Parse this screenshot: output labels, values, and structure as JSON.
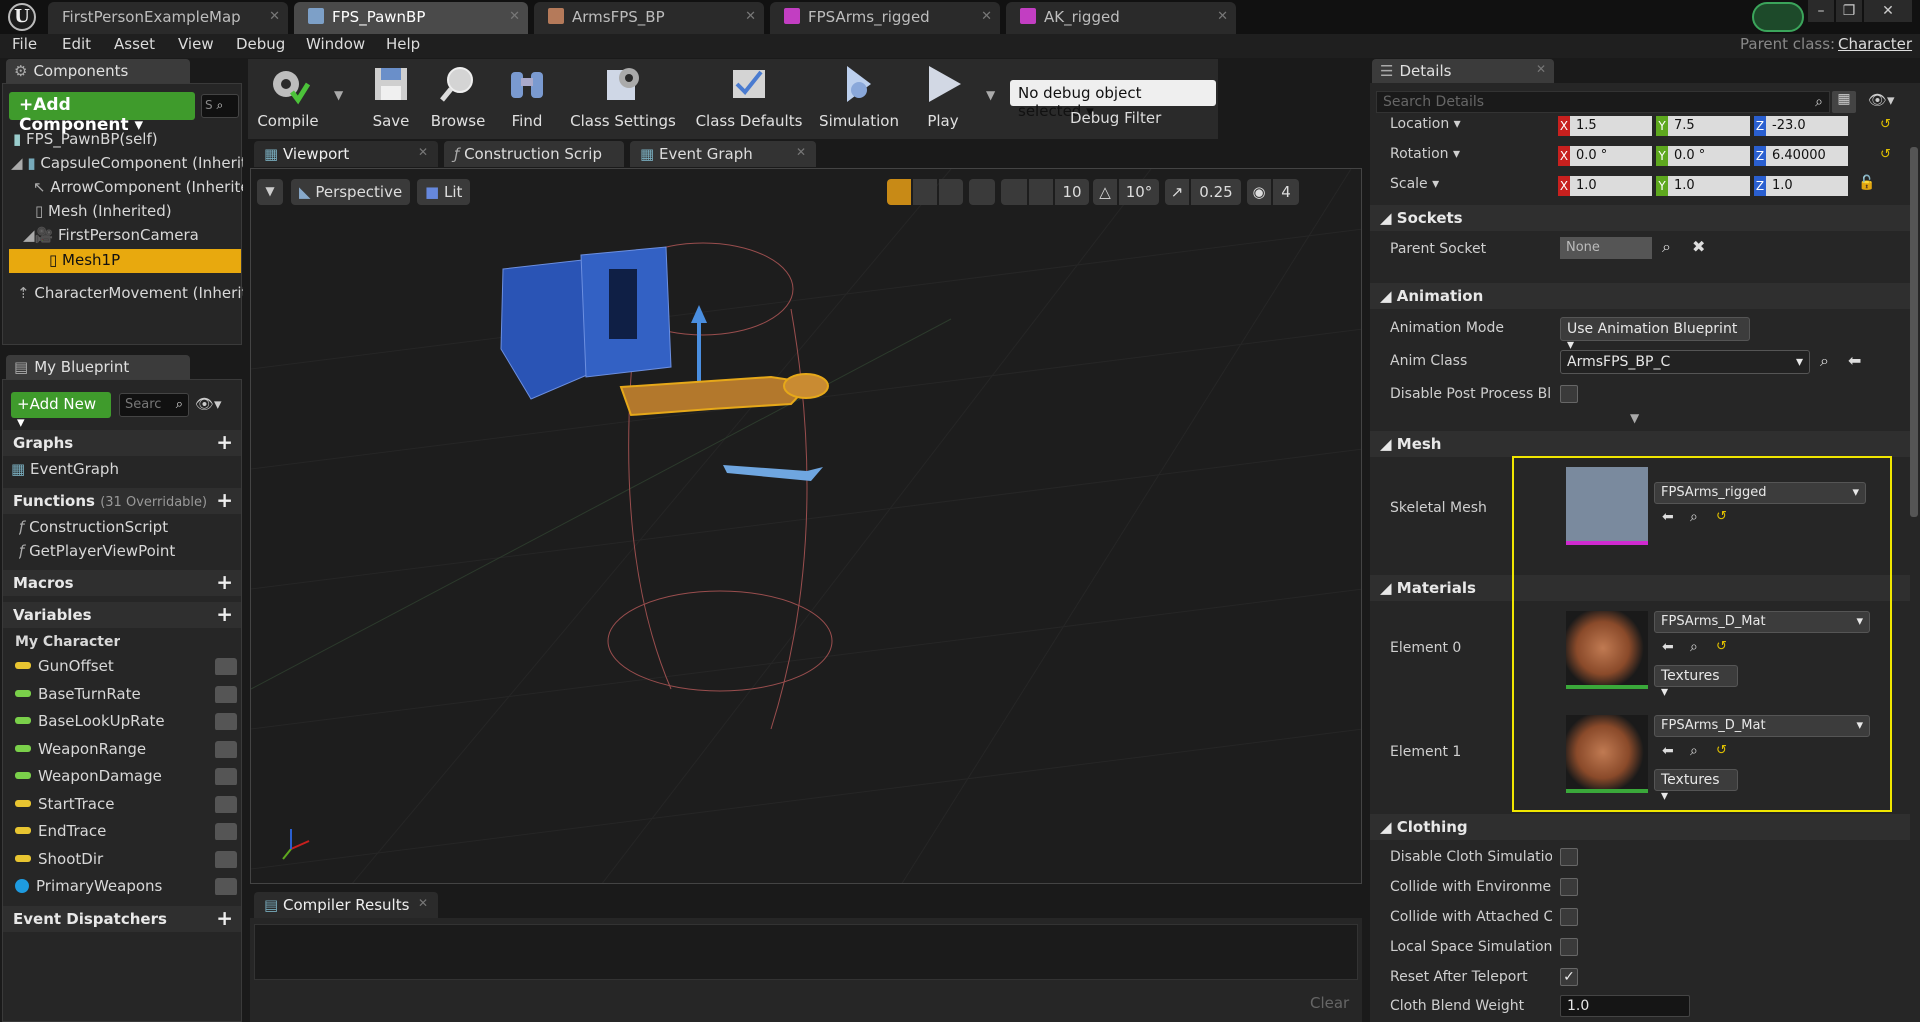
{
  "tabs": [
    {
      "label": "FirstPersonExampleMap",
      "active": false
    },
    {
      "label": "FPS_PawnBP",
      "active": true
    },
    {
      "label": "ArmsFPS_BP",
      "active": false
    },
    {
      "label": "FPSArms_rigged",
      "active": false
    },
    {
      "label": "AK_rigged",
      "active": false
    }
  ],
  "menu": [
    "File",
    "Edit",
    "Asset",
    "View",
    "Debug",
    "Window",
    "Help"
  ],
  "parent_class": {
    "label": "Parent class:",
    "value": "Character"
  },
  "components": {
    "title": "Components",
    "add_button": "+Add Component",
    "search_placeholder": "S",
    "root": "FPS_PawnBP(self)",
    "items": [
      {
        "label": "CapsuleComponent (Inherite"
      },
      {
        "label": "ArrowComponent (Inherite"
      },
      {
        "label": "Mesh (Inherited)"
      },
      {
        "label": "FirstPersonCamera"
      },
      {
        "label": "Mesh1P",
        "selected": true
      },
      {
        "label": "CharacterMovement (Inherit"
      }
    ]
  },
  "my_blueprint": {
    "title": "My Blueprint",
    "add_new": "Add New",
    "search_placeholder": "Searc",
    "graphs": {
      "label": "Graphs",
      "items": [
        "EventGraph"
      ]
    },
    "functions": {
      "label": "Functions",
      "count": "(31 Overridable)",
      "items": [
        "ConstructionScript",
        "GetPlayerViewPoint"
      ]
    },
    "macros": "Macros",
    "variables": {
      "label": "Variables",
      "category": "My Character",
      "items": [
        {
          "name": "GunOffset",
          "color": "#e8c531"
        },
        {
          "name": "BaseTurnRate",
          "color": "#7ad04a"
        },
        {
          "name": "BaseLookUpRate",
          "color": "#7ad04a"
        },
        {
          "name": "WeaponRange",
          "color": "#7ad04a"
        },
        {
          "name": "WeaponDamage",
          "color": "#7ad04a"
        },
        {
          "name": "StartTrace",
          "color": "#e8c531"
        },
        {
          "name": "EndTrace",
          "color": "#e8c531"
        },
        {
          "name": "ShootDir",
          "color": "#e8c531"
        },
        {
          "name": "PrimaryWeapons",
          "color": "#1e9be0"
        }
      ]
    },
    "event_dispatchers": "Event Dispatchers"
  },
  "toolbar": {
    "buttons": [
      "Compile",
      "Save",
      "Browse",
      "Find",
      "Class Settings",
      "Class Defaults",
      "Simulation",
      "Play"
    ],
    "debug_select": "No debug object selected",
    "debug_filter": "Debug Filter"
  },
  "editor_tabs": [
    "Viewport",
    "Construction Scrip",
    "Event Graph"
  ],
  "viewport": {
    "perspective": "Perspective",
    "lit": "Lit",
    "grid_snap": "10",
    "rot_snap": "10°",
    "scale_snap": "0.25",
    "cam_speed": "4"
  },
  "compiler": {
    "title": "Compiler Results",
    "clear": "Clear"
  },
  "details": {
    "title": "Details",
    "search_placeholder": "Search Details",
    "transform": {
      "location": {
        "label": "Location",
        "x": "1.5",
        "y": "7.5",
        "z": "-23.0"
      },
      "rotation": {
        "label": "Rotation",
        "x": "0.0 °",
        "y": "0.0 °",
        "z": "6.40000"
      },
      "scale": {
        "label": "Scale",
        "x": "1.0",
        "y": "1.0",
        "z": "1.0"
      }
    },
    "sockets": {
      "header": "Sockets",
      "parent_socket_label": "Parent Socket",
      "parent_socket_value": "None"
    },
    "animation": {
      "header": "Animation",
      "mode_label": "Animation Mode",
      "mode_value": "Use Animation Blueprint",
      "class_label": "Anim Class",
      "class_value": "ArmsFPS_BP_C",
      "disable_pp_label": "Disable Post Process Blu"
    },
    "mesh": {
      "header": "Mesh",
      "skeletal_label": "Skeletal Mesh",
      "skeletal_value": "FPSArms_rigged"
    },
    "materials": {
      "header": "Materials",
      "elements": [
        {
          "label": "Element 0",
          "value": "FPSArms_D_Mat",
          "textures": "Textures"
        },
        {
          "label": "Element 1",
          "value": "FPSArms_D_Mat",
          "textures": "Textures"
        }
      ]
    },
    "clothing": {
      "header": "Clothing",
      "options": [
        {
          "label": "Disable Cloth Simulation",
          "checked": false
        },
        {
          "label": "Collide with Environment",
          "checked": false
        },
        {
          "label": "Collide with Attached Chi",
          "checked": false
        },
        {
          "label": "Local Space Simulation",
          "checked": false
        },
        {
          "label": "Reset After Teleport",
          "checked": true
        }
      ],
      "blend_label": "Cloth Blend Weight",
      "blend_value": "1.0"
    }
  },
  "colors": {
    "highlight": "#f0c800",
    "accent_green": "#3f9b2c",
    "x_axis": "#c8201e",
    "y_axis": "#5ea81e",
    "z_axis": "#2a5fd0"
  }
}
